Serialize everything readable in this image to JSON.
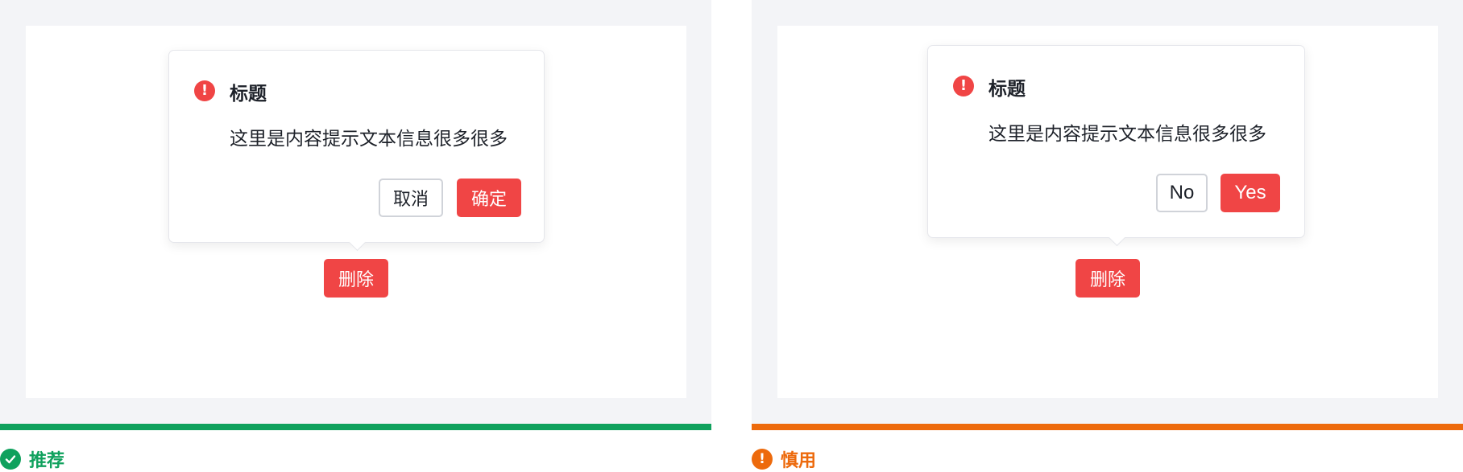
{
  "colors": {
    "panel_background": "#f3f4f7",
    "card_background": "#ffffff",
    "danger_red": "#f04545",
    "recommend_green": "#0fa15d",
    "caution_orange": "#ed6a0c",
    "text_primary": "#1d2129",
    "border_gray": "#d0d3d9"
  },
  "left_example": {
    "popover": {
      "icon": "exclamation-circle-icon",
      "icon_glyph": "!",
      "title": "标题",
      "content": "这里是内容提示文本信息很多很多",
      "cancel_label": "取消",
      "confirm_label": "确定"
    },
    "trigger_label": "删除",
    "verdict": {
      "icon": "check-circle-icon",
      "label": "推荐"
    }
  },
  "right_example": {
    "popover": {
      "icon": "exclamation-circle-icon",
      "icon_glyph": "!",
      "title": "标题",
      "content": "这里是内容提示文本信息很多很多",
      "cancel_label": "No",
      "confirm_label": "Yes"
    },
    "trigger_label": "删除",
    "verdict": {
      "icon": "exclamation-circle-icon",
      "icon_glyph": "!",
      "label": "慎用"
    }
  }
}
